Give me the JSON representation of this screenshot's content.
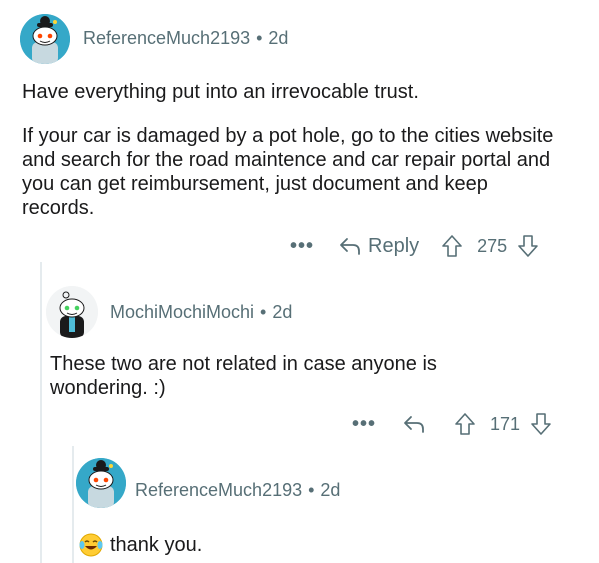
{
  "comments": [
    {
      "author": "ReferenceMuch2193",
      "age": "2d",
      "paragraphs": [
        "Have everything put into an irrevocable trust.",
        "If your car is damaged by a pot hole, go to the cities website and search for the road maintence and car repair portal and you can get reimbursement, just document and keep records."
      ],
      "more_label": "•••",
      "reply_label": "Reply",
      "score": "275",
      "avatar_icon": "snoo-avatar-icon"
    },
    {
      "author": "MochiMochiMochi",
      "age": "2d",
      "paragraphs": [
        "These two are not related in case anyone is wondering. :)"
      ],
      "more_label": "•••",
      "score": "171",
      "avatar_icon": "snoo-avatar-icon"
    },
    {
      "author": "ReferenceMuch2193",
      "age": "2d",
      "text": "thank you.",
      "emoji_icon": "laughing-tears-emoji-icon",
      "avatar_icon": "snoo-avatar-icon"
    }
  ],
  "separator": "•",
  "colors": {
    "meta": "#576f76",
    "text": "#1a1a1b",
    "thread_line": "#e5ebee",
    "avatar_bg": "#35a8c8"
  }
}
